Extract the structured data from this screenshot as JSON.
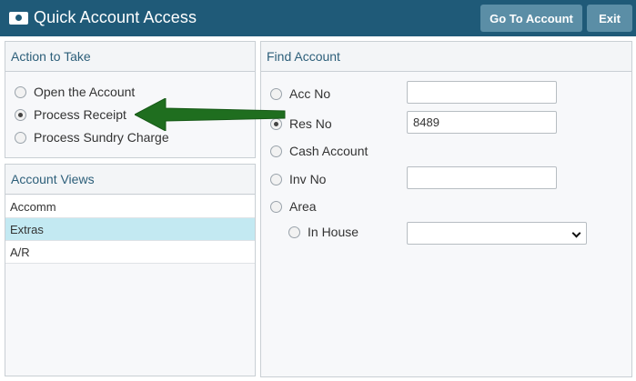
{
  "window": {
    "title": "Quick Account Access",
    "buttons": {
      "go_to_account": "Go To Account",
      "exit": "Exit"
    }
  },
  "action_panel": {
    "header": "Action to Take",
    "options": [
      {
        "label": "Open the Account",
        "checked": false
      },
      {
        "label": "Process Receipt",
        "checked": true
      },
      {
        "label": "Process Sundry Charge",
        "checked": false
      }
    ]
  },
  "views_panel": {
    "header": "Account Views",
    "items": [
      {
        "label": "Accomm",
        "selected": false
      },
      {
        "label": "Extras",
        "selected": true
      },
      {
        "label": "A/R",
        "selected": false
      }
    ]
  },
  "find_panel": {
    "header": "Find Account",
    "options": {
      "acc_no": {
        "label": "Acc No",
        "checked": false,
        "value": ""
      },
      "res_no": {
        "label": "Res No",
        "checked": true,
        "value": "8489"
      },
      "cash_account": {
        "label": "Cash Account",
        "checked": false
      },
      "inv_no": {
        "label": "Inv No",
        "checked": false,
        "value": ""
      },
      "area": {
        "label": "Area",
        "checked": false
      },
      "in_house": {
        "label": "In House",
        "checked": false,
        "selected": ""
      }
    }
  },
  "colors": {
    "titlebar": "#1f5a78",
    "button": "#5b8ea6",
    "selected_row": "#c3e9f2",
    "panel_header_text": "#2d5f7a",
    "arrow": "#1f6e1f"
  },
  "icons": {
    "app": "cash-icon",
    "dropdown": "chevron-down-icon",
    "annotation": "arrow-left-icon"
  }
}
